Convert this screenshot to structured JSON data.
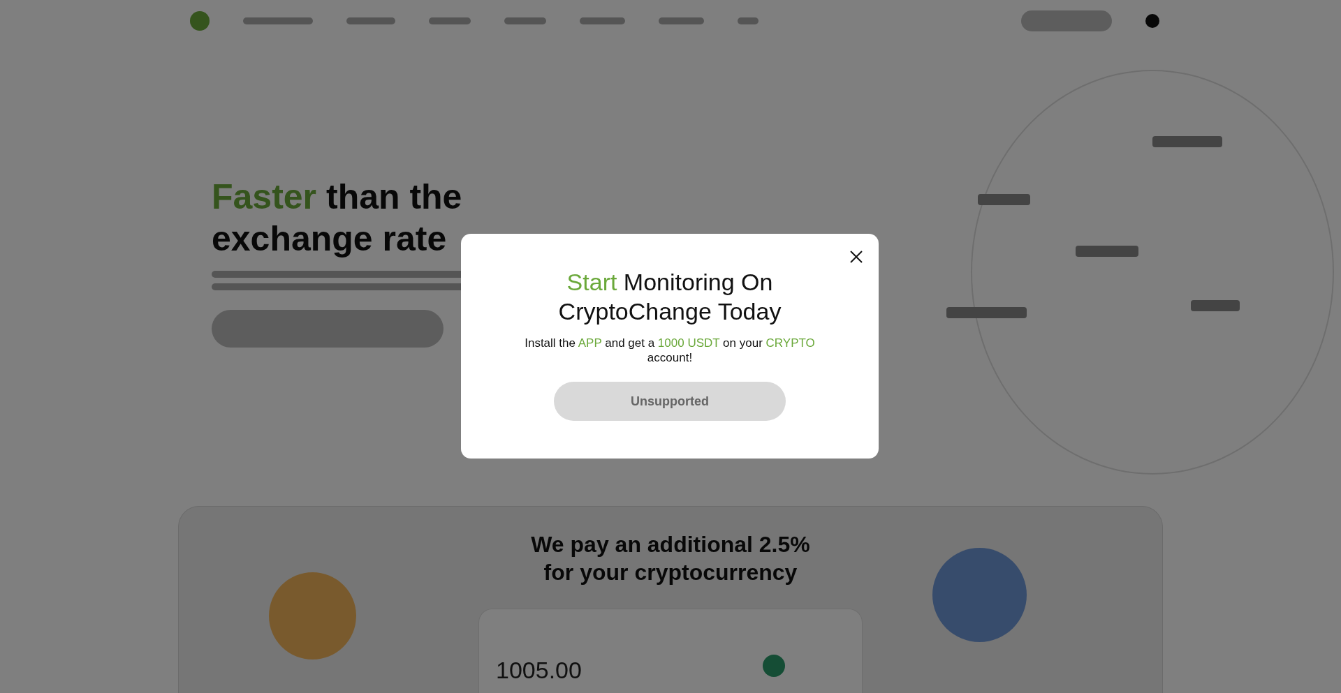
{
  "hero": {
    "title_highlight": "Faster",
    "title_line1": "than the",
    "title_line2": "exchange rate"
  },
  "offer": {
    "title": "We pay an additional 2.5% for your cryptocurrency",
    "amount": "1005.00"
  },
  "modal": {
    "title_highlight": "Start",
    "title_rest": "Monitoring On CryptoChange Today",
    "message": [
      {
        "text": "Install the",
        "highlight": false
      },
      {
        "text": "APP",
        "highlight": true
      },
      {
        "text": "and get a",
        "highlight": false
      },
      {
        "text": "1000 USDT",
        "highlight": true
      },
      {
        "text": "on your",
        "highlight": false
      },
      {
        "text": "CRYPTO",
        "highlight": true
      },
      {
        "text": "account!",
        "highlight": false
      }
    ],
    "button": {
      "label": "Unsupported",
      "disabled": true
    }
  }
}
